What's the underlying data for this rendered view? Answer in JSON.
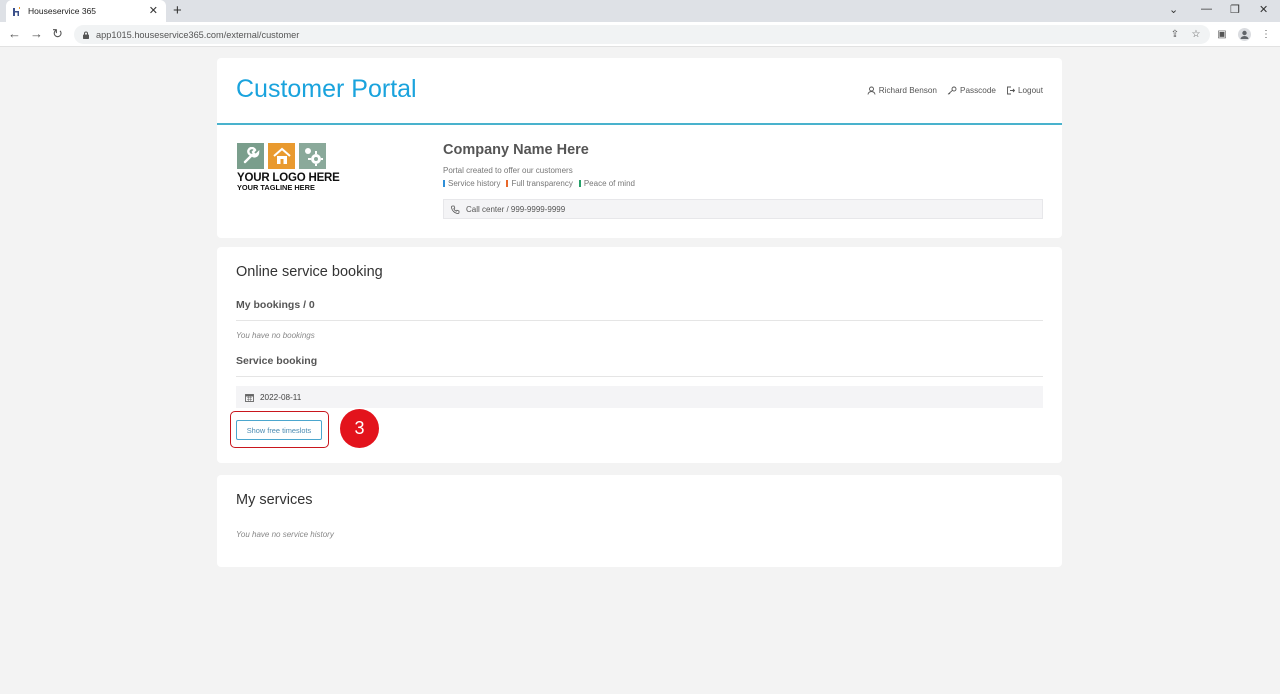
{
  "browser": {
    "tab_title": "Houseservice 365",
    "url": "app1015.houseservice365.com/external/customer"
  },
  "header": {
    "title": "Customer Portal",
    "nav": {
      "user": "Richard Benson",
      "passcode": "Passcode",
      "logout": "Logout"
    },
    "accent_color": "#1aa3dd"
  },
  "company": {
    "logo_line1": "YOUR LOGO HERE",
    "logo_line2": "YOUR TAGLINE HERE",
    "name": "Company Name Here",
    "subtitle": "Portal created to offer our customers",
    "tags": [
      {
        "label": "Service history",
        "color": "#2f8fd8"
      },
      {
        "label": "Full transparency",
        "color": "#e8682a"
      },
      {
        "label": "Peace of mind",
        "color": "#27a06a"
      }
    ],
    "call_center": "Call center / 999-9999-9999"
  },
  "booking": {
    "title": "Online service booking",
    "my_bookings": "My bookings / 0",
    "no_bookings": "You have no bookings",
    "service_booking": "Service booking",
    "date_value": "2022-08-11",
    "show_slots": "Show free timeslots",
    "step_badge": "3"
  },
  "services": {
    "title": "My services",
    "no_history": "You have no service history"
  }
}
